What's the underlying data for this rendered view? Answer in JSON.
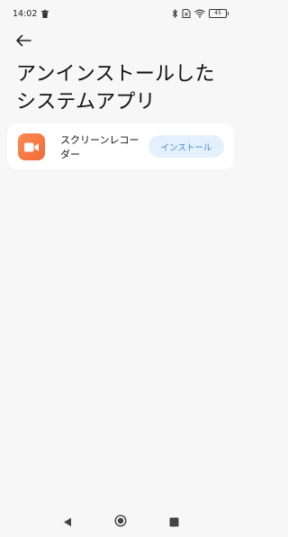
{
  "status_bar": {
    "time": "14:02",
    "battery_level": "45",
    "icons": [
      "trash-icon",
      "bluetooth-icon",
      "sim-card-icon",
      "wifi-icon",
      "battery-icon"
    ]
  },
  "header": {
    "back_icon": "arrow-left-icon",
    "title": "アンインストールした システムアプリ"
  },
  "apps": [
    {
      "name": "スクリーンレコーダー",
      "icon": "video-camera-icon",
      "icon_color": "#f07540",
      "action_label": "インストール"
    }
  ],
  "navigation_bar": {
    "buttons": [
      "back-triangle-icon",
      "home-circle-icon",
      "recents-square-icon"
    ]
  },
  "colors": {
    "background": "#f7f7f7",
    "card": "#ffffff",
    "install_button_bg": "#e4f0fb",
    "install_button_text": "#3c8fd6"
  }
}
